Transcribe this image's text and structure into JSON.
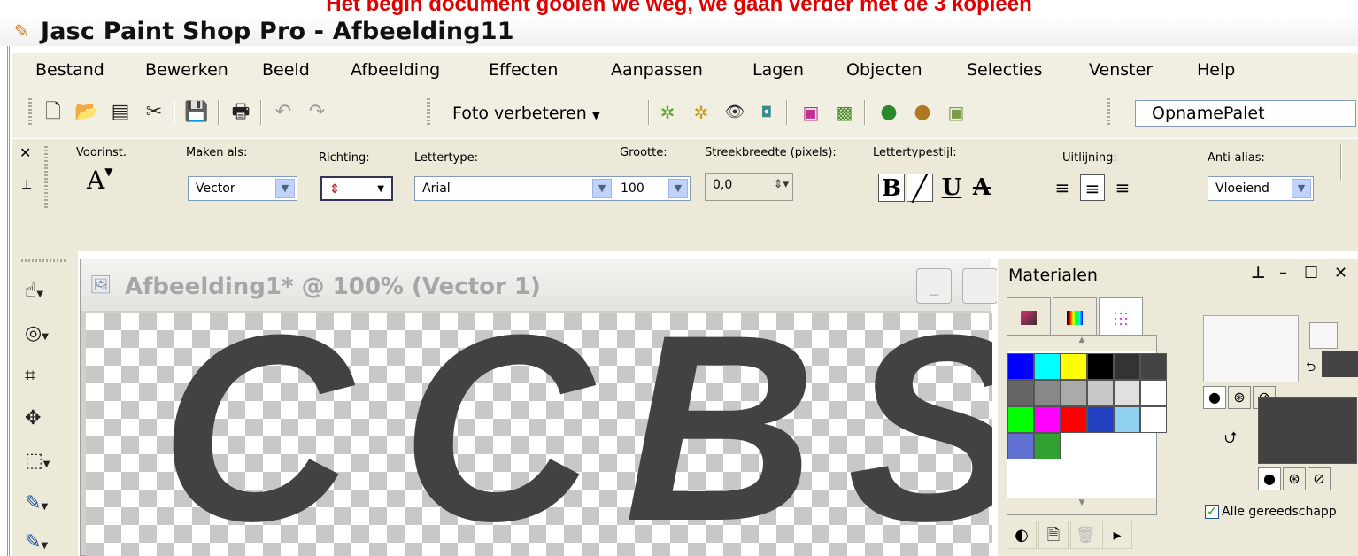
{
  "caption": "Het begin document gooien we weg, we gaan verder met de 3 kopieen",
  "window": {
    "title": "Jasc Paint Shop Pro - Afbeelding11"
  },
  "menu": [
    "Bestand",
    "Bewerken",
    "Beeld",
    "Afbeelding",
    "Effecten",
    "Aanpassen",
    "Lagen",
    "Objecten",
    "Selecties",
    "Venster",
    "Help"
  ],
  "toolbar": {
    "foto_label": "Foto verbeteren",
    "palette_select": "OpnamePalet"
  },
  "options": {
    "voorinst_label": "Voorinst.",
    "voorinst_icon": "A",
    "maken_als_label": "Maken als:",
    "maken_als_value": "Vector",
    "richting_label": "Richting:",
    "lettertype_label": "Lettertype:",
    "lettertype_value": "Arial",
    "grootte_label": "Grootte:",
    "grootte_value": "100",
    "streek_label": "Streekbreedte (pixels):",
    "streek_value": "0,0",
    "letterstijl_label": "Lettertypestijl:",
    "bold": "B",
    "italic": "I",
    "underline": "U",
    "strike": "A",
    "uitlijning_label": "Uitlijning:",
    "antialias_label": "Anti-alias:",
    "antialias_value": "Vloeiend"
  },
  "document": {
    "title": "Afbeelding1* @  100% (Vector 1)",
    "letters": [
      "C",
      "C",
      "B",
      "S"
    ]
  },
  "materials": {
    "title": "Materialen",
    "checkbox_label": "Alle gereedschapp",
    "checked": true
  },
  "colors": {
    "caption": "#e00000",
    "canvas_text": "#424242",
    "swatches": [
      "#0000ff",
      "#00ffff",
      "#ffff00",
      "#000000",
      "#333333",
      "#444444",
      "#666666",
      "#888888",
      "#aaaaaa",
      "#c8c8c8",
      "#e0e0e0",
      "#ffffff",
      "#00ff00",
      "#ff00ff",
      "#ff0000",
      "#2040c0",
      "#8fd0f0",
      "#ffffff",
      "#6070d0",
      "#30a030"
    ]
  }
}
